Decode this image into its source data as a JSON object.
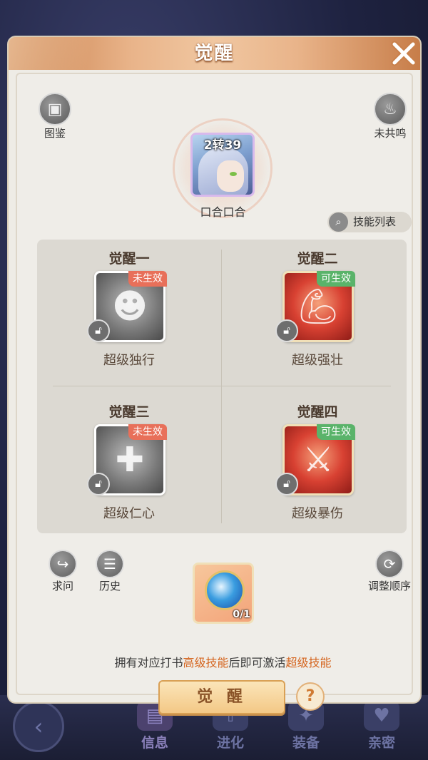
{
  "modal": {
    "title": "觉醒",
    "pet": {
      "level_badge": "2转39",
      "name": "口合口合"
    },
    "left_button": {
      "label": "图鉴"
    },
    "right_button": {
      "label": "未共鸣"
    },
    "skill_list_button": {
      "label": "技能列表"
    },
    "skills": [
      {
        "slot": "觉醒一",
        "name": "超级独行",
        "status": "未生效",
        "active": false
      },
      {
        "slot": "觉醒二",
        "name": "超级强壮",
        "status": "可生效",
        "active": true
      },
      {
        "slot": "觉醒三",
        "name": "超级仁心",
        "status": "未生效",
        "active": false
      },
      {
        "slot": "觉醒四",
        "name": "超级暴伤",
        "status": "可生效",
        "active": true
      }
    ],
    "tools": {
      "ask": "求问",
      "history": "历史",
      "reorder": "调整顺序"
    },
    "item": {
      "count": "0/1"
    },
    "hint": {
      "part1": "拥有对应打书",
      "highlight1": "高级技能",
      "part2": "后即可激活",
      "highlight2": "超级技能"
    },
    "awaken_button": "觉 醒",
    "help_button": "?"
  },
  "background_nav": {
    "tabs": [
      {
        "label": "信息",
        "active": true
      },
      {
        "label": "进化",
        "active": false
      },
      {
        "label": "装备",
        "active": false
      },
      {
        "label": "亲密",
        "active": false
      }
    ]
  },
  "colors": {
    "highlight": "#d5651f",
    "badge_inactive": "#e8705a",
    "badge_active": "#5ab36a",
    "header": "#e9b48a"
  }
}
